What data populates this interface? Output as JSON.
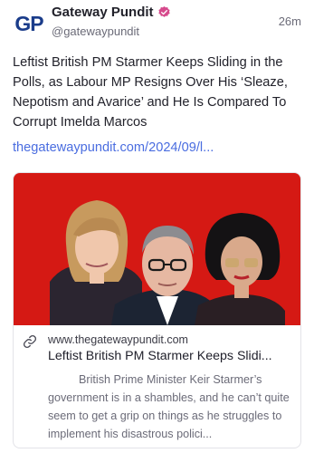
{
  "author": {
    "name": "Gateway Pundit",
    "handle": "@gatewaypundit",
    "avatar_text": "GP",
    "verified": true,
    "verified_icon": "verified-badge-icon",
    "brand_color": "#1a3c8a"
  },
  "post": {
    "time": "26m",
    "text": "Leftist British PM Starmer Keeps Sliding in the Polls, as Labour MP Resigns Over His ‘Sleaze, Nepotism and Avarice’ and He Is Compared To Corrupt Imelda Marcos",
    "link_text": "thegatewaypundit.com/2024/09/l..."
  },
  "card": {
    "domain": "www.thegatewaypundit.com",
    "title": "Leftist British PM Starmer Keeps Slidi...",
    "description": "British Prime Minister Keir Starmer’s government is in a shambles, and he can’t quite seem to get a grip on things as he struggles to implement his disastrous polici...",
    "link_icon": "link-icon",
    "image_background": "#e01c17"
  },
  "colors": {
    "link": "#4a6de0",
    "verified_badge": "#d64a8c",
    "muted_text": "#6b6b78"
  }
}
